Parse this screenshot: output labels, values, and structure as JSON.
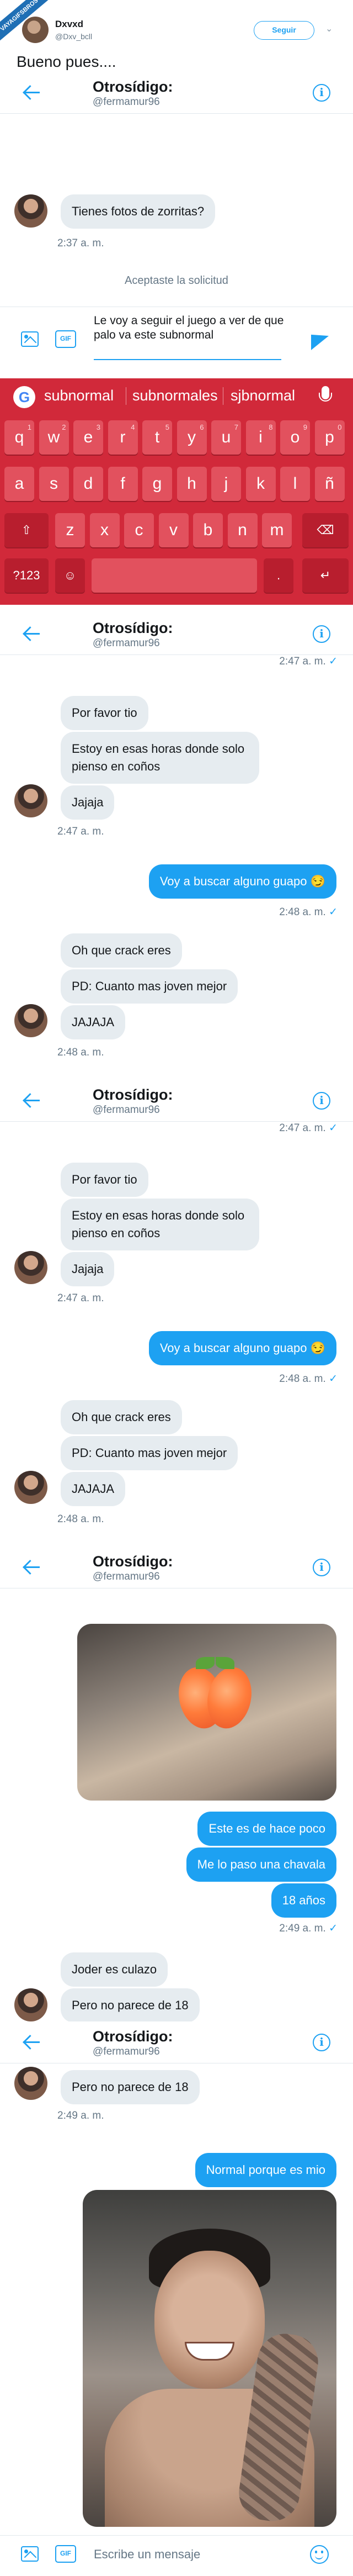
{
  "tweet": {
    "ribbon": "VAYAGIFSBROS",
    "author_name": "Dxvxd",
    "author_handle": "@Dxv_bcll",
    "follow_label": "Seguir",
    "text": "Bueno pues...."
  },
  "chat_header": {
    "name": "Otrosídigo:",
    "handle": "@fermamur96"
  },
  "section1": {
    "message": "Tienes fotos de zorritas?",
    "time": "2:37 a. m.",
    "accepted_notice": "Aceptaste la solicitud",
    "compose_text": "Le voy a seguir el juego a ver de que palo va este subnormal",
    "gif_label": "GIF"
  },
  "keyboard": {
    "suggestions": [
      "subnormal",
      "subnormales",
      "sjbnormal"
    ],
    "row1": [
      {
        "k": "q",
        "n": "1"
      },
      {
        "k": "w",
        "n": "2"
      },
      {
        "k": "e",
        "n": "3"
      },
      {
        "k": "r",
        "n": "4"
      },
      {
        "k": "t",
        "n": "5"
      },
      {
        "k": "y",
        "n": "6"
      },
      {
        "k": "u",
        "n": "7"
      },
      {
        "k": "i",
        "n": "8"
      },
      {
        "k": "o",
        "n": "9"
      },
      {
        "k": "p",
        "n": "0"
      }
    ],
    "row2": [
      "a",
      "s",
      "d",
      "f",
      "g",
      "h",
      "j",
      "k",
      "l",
      "ñ"
    ],
    "row3": [
      "z",
      "x",
      "c",
      "v",
      "b",
      "n",
      "m"
    ],
    "numbers_key": "?123",
    "comma_key": ",",
    "period_key": ".",
    "enter_key": "↵",
    "shift_key": "⇧",
    "backspace_key": "⌫",
    "emoji_key": "☺"
  },
  "conversation_a": {
    "cut_time": "2:47 a. m.",
    "in_group_1": [
      "Por favor tio",
      "Estoy en esas horas donde solo pienso en coños",
      "Jajaja"
    ],
    "in_time_1": "2:47 a. m.",
    "out_1": "Voy a buscar alguno guapo 😏",
    "out_time_1": "2:48 a. m.",
    "in_group_2": [
      "Oh que crack eres",
      "PD: Cuanto mas joven mejor",
      "JAJAJA"
    ],
    "in_time_2": "2:48 a. m."
  },
  "section4": {
    "out_msgs": [
      "Este es de hace poco",
      "Me lo paso una chavala",
      "18 años"
    ],
    "out_time": "2:49 a. m.",
    "in_msgs": [
      "Joder es culazo",
      "Pero no parece de 18"
    ]
  },
  "section5": {
    "in_msg": "Pero no parece de 18",
    "in_time": "2:49 a. m.",
    "out_msg": "Normal porque es mio",
    "placeholder": "Escribe un mensaje",
    "gif_label": "GIF"
  },
  "colors": {
    "accent": "#1da1f2",
    "bubble_in": "#e6ecf0",
    "keyboard": "#d1293a",
    "text_secondary": "#657786"
  },
  "icons": [
    "back-arrow-icon",
    "info-icon",
    "image-icon",
    "gif-icon",
    "send-icon",
    "google-icon",
    "mic-icon",
    "emoji-icon",
    "chevron-down-icon",
    "check-icon"
  ]
}
